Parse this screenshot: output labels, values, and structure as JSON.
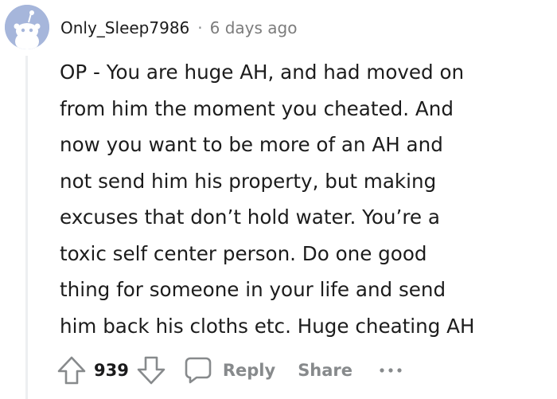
{
  "comment": {
    "author": "Only_Sleep7986",
    "separator": "·",
    "time_ago": "6 days ago",
    "body_lines": [
      "OP - You are huge AH, and had moved on",
      "from him the moment you cheated. And",
      "now you want to be more of an AH and",
      "not send him his property, but making",
      "excuses that don’t hold water. You’re a",
      "toxic self center person. Do one good",
      "thing for someone in your life and send",
      "him back his cloths etc. Huge cheating AH"
    ]
  },
  "actions": {
    "vote_count": "939",
    "reply_label": "Reply",
    "share_label": "Share",
    "more_label": "•••"
  },
  "icons": {
    "upvote": "arrow-up-icon",
    "downvote": "arrow-down-icon",
    "reply": "speech-bubble-icon",
    "avatar": "snoo-avatar"
  },
  "colors": {
    "avatar_bg": "#a6b6db",
    "muted_text": "#878a8c",
    "thread_line": "#edeff1"
  }
}
